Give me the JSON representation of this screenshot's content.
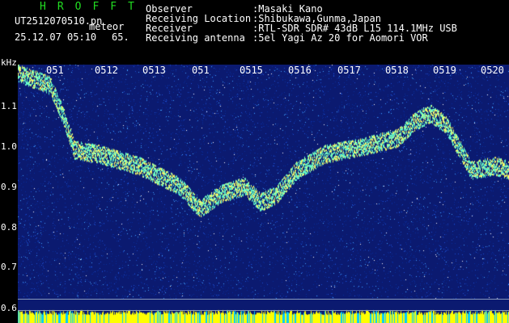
{
  "header": {
    "app_name": "HROFFT",
    "file_name": "UT2512070510.pn",
    "mode": "meteor",
    "date_time": "25.12.07 05:10",
    "value": "65."
  },
  "info": {
    "labels": [
      "Observer",
      "Receiving Location",
      "Receiver",
      "Receiving antenna"
    ],
    "values": [
      ":Masaki Kano",
      ":Shibukawa,Gunma,Japan",
      ":RTL-SDR SDR# 43dB L15 114.1MHz USB",
      ":5el Yagi Az 20 for Aomori VOR"
    ]
  },
  "axis": {
    "y_unit": "kHz",
    "y_ticks": [
      "1.1",
      "1.0",
      "0.9",
      "0.8",
      "0.7",
      "0.6"
    ],
    "x_ticks": [
      "051",
      "0512",
      "0513",
      "051",
      "0515",
      "0516",
      "0517",
      "0518",
      "0519",
      "0520"
    ]
  },
  "colors": {
    "background": "#000000",
    "plot_background": "#0b1a70",
    "header_text": "#ffffff",
    "title_text": "#22dd22",
    "trace": "#ffff66",
    "trace_cyan": "#66ffcc",
    "bottom_band": "#ffff00",
    "bottom_band_alt": "#00ccff"
  }
}
